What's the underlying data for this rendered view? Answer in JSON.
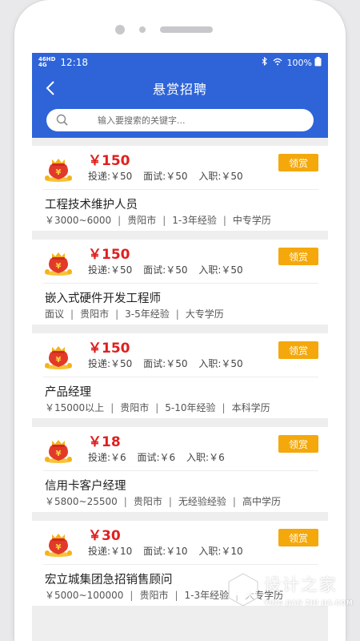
{
  "status_bar": {
    "network": [
      "46HD",
      "4G"
    ],
    "time": "12:18",
    "battery": "100%",
    "bluetooth_icon": "bluetooth-icon",
    "wifi_icon": "wifi-icon"
  },
  "header": {
    "title": "悬赏招聘",
    "back_icon": "chevron-left-icon"
  },
  "search": {
    "placeholder": "输入要搜索的关键字..."
  },
  "colors": {
    "header_blue": "#2e64d8",
    "reward_red": "#e01f1f",
    "claim_orange": "#f4a80c"
  },
  "jobs": [
    {
      "reward": "￥150",
      "delivery": "投递:￥50",
      "interview": "面试:￥50",
      "onboard": "入职:￥50",
      "claim_label": "领赏",
      "title": "工程技术维护人员",
      "salary": "￥3000~6000",
      "city": "贵阳市",
      "experience": "1-3年经验",
      "education": "中专学历"
    },
    {
      "reward": "￥150",
      "delivery": "投递:￥50",
      "interview": "面试:￥50",
      "onboard": "入职:￥50",
      "claim_label": "领赏",
      "title": "嵌入式硬件开发工程师",
      "salary": "面议",
      "city": "贵阳市",
      "experience": "3-5年经验",
      "education": "大专学历"
    },
    {
      "reward": "￥150",
      "delivery": "投递:￥50",
      "interview": "面试:￥50",
      "onboard": "入职:￥50",
      "claim_label": "领赏",
      "title": "产品经理",
      "salary": "￥15000以上",
      "city": "贵阳市",
      "experience": "5-10年经验",
      "education": "本科学历"
    },
    {
      "reward": "￥18",
      "delivery": "投递:￥6",
      "interview": "面试:￥6",
      "onboard": "入职:￥6",
      "claim_label": "领赏",
      "title": "信用卡客户经理",
      "salary": "￥5800~25500",
      "city": "贵阳市",
      "experience": "无经验经验",
      "education": "高中学历"
    },
    {
      "reward": "￥30",
      "delivery": "投递:￥10",
      "interview": "面试:￥10",
      "onboard": "入职:￥10",
      "claim_label": "领赏",
      "title": "宏立城集团急招销售顾问",
      "salary": "￥5000~100000",
      "city": "贵阳市",
      "experience": "1-3年经验",
      "education": "大专学历"
    }
  ],
  "watermark": {
    "text_cn": "设计之家",
    "text_en": "YING JIAN ZHI JIA.COM"
  }
}
